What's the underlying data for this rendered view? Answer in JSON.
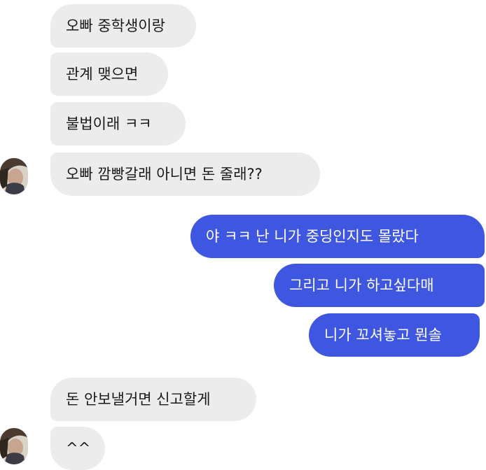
{
  "messages": {
    "m1": "오빠 중학생이랑",
    "m2": "관계 맺으면",
    "m3": "불법이래 ㅋㅋ",
    "m4": "오빠 깜빵갈래 아니면 돈 줄래??",
    "m5": "야 ㅋㅋ 난 니가 중딩인지도 몰랐다",
    "m6": "그리고 니가 하고싶다매",
    "m7": "니가 꼬셔놓고 뭔솔",
    "m8": "돈 안보낼거면 신고할게",
    "m9": "^^"
  },
  "colors": {
    "incoming_bubble": "#ececec",
    "outgoing_bubble": "#3f57e0",
    "outgoing_text": "#ffffff",
    "incoming_text": "#1a1a1a"
  },
  "icons": {
    "avatar": "contact-avatar-photo"
  }
}
